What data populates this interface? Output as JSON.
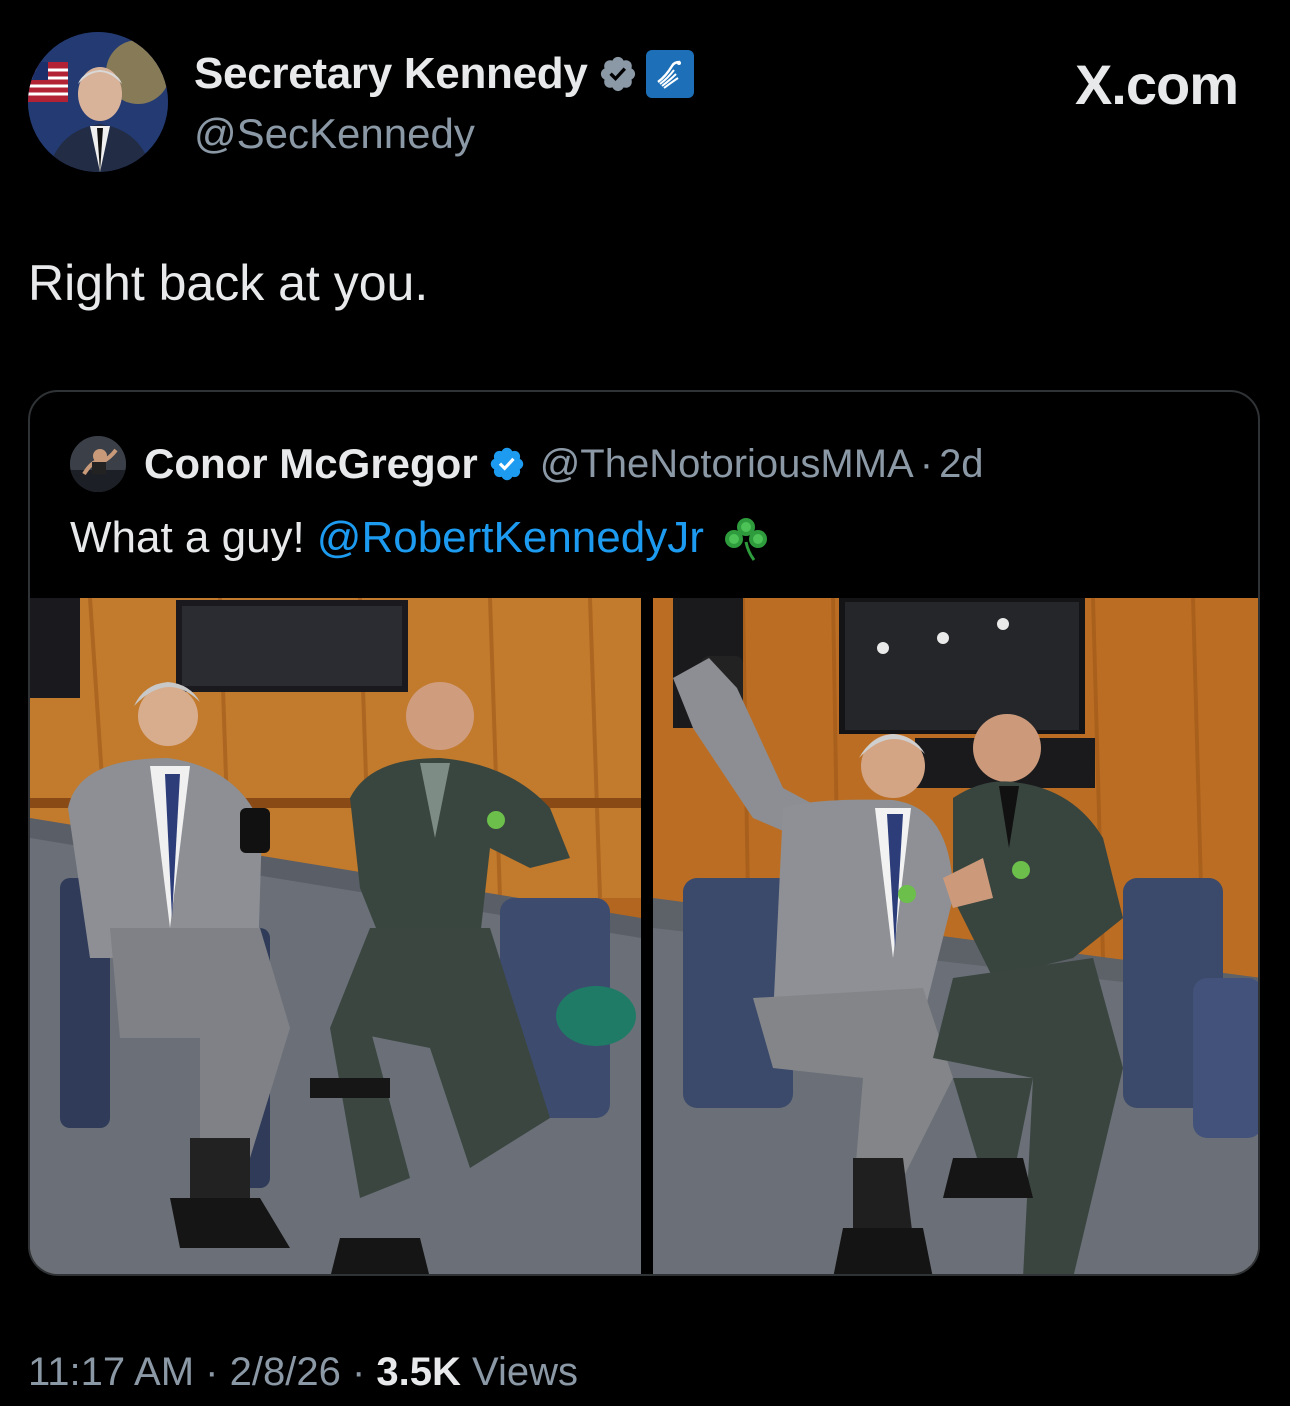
{
  "header": {
    "display_name": "Secretary Kennedy",
    "handle": "@SecKennedy",
    "site_logo": "X.com",
    "verified_icon": "verified-badge-icon",
    "affiliation_icon": "hhs-eagle-icon"
  },
  "tweet": {
    "text": "Right back at you."
  },
  "quoted_tweet": {
    "display_name": "Conor McGregor",
    "handle": "@TheNotoriousMMA",
    "separator": "·",
    "age": "2d",
    "text_prefix": "What a guy!",
    "mention": "@RobertKennedyJr",
    "emoji_icon": "shamrock-icon",
    "photos": [
      {
        "name": "photo-seated-conversation"
      },
      {
        "name": "photo-selfie"
      }
    ]
  },
  "meta": {
    "time": "11:17 AM",
    "sep1": "·",
    "date": "2/8/26",
    "sep2": "·",
    "views_count": "3.5K",
    "views_label": "Views"
  },
  "colors": {
    "background": "#000000",
    "text": "#e7e9ea",
    "secondary": "#8b98a5",
    "link": "#1d9bf0",
    "border": "#2f3336",
    "verified": "#1d9bf0"
  }
}
